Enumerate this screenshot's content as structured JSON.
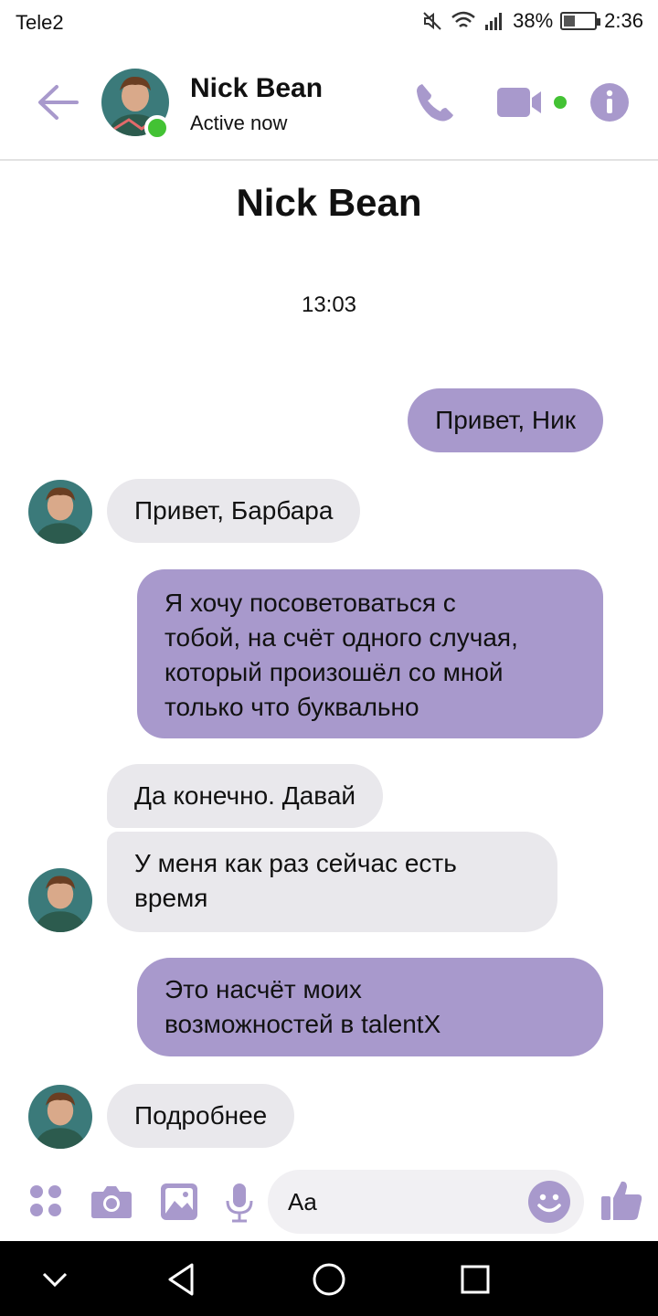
{
  "status_bar": {
    "carrier": "Tele2",
    "battery": "38%",
    "battery_level": 0.38,
    "time": "2:36"
  },
  "header": {
    "name": "Nick Bean",
    "status": "Active now"
  },
  "chat": {
    "title": "Nick Bean",
    "timestamp": "13:03",
    "messages": [
      {
        "from": "me",
        "lines": [
          "Привет, Ник"
        ]
      },
      {
        "from": "contact",
        "lines": [
          "Привет, Барбара"
        ]
      },
      {
        "from": "me",
        "lines": [
          "Я хочу посоветоваться с",
          "тобой, на счёт одного случая,",
          "который произошёл со мной",
          "только что буквально"
        ]
      },
      {
        "from": "contact",
        "lines": [
          "Да конечно. Давай"
        ]
      },
      {
        "from": "contact",
        "lines": [
          "У меня как раз сейчас есть",
          "время"
        ]
      },
      {
        "from": "me",
        "lines": [
          "Это насчёт моих",
          "возможностей в talentX"
        ]
      },
      {
        "from": "contact",
        "lines": [
          "Подробнее"
        ]
      }
    ]
  },
  "composer": {
    "placeholder": "Aa",
    "icons": [
      "apps-icon",
      "camera-icon",
      "gallery-icon",
      "microphone-icon",
      "emoji-icon",
      "thumbs-up-icon"
    ]
  },
  "colors": {
    "accent": "#a899cc",
    "outgoing_bubble": "#a899cc",
    "incoming_bubble": "#e9e8ec",
    "online": "#43c234",
    "icon": "#a899cc"
  }
}
